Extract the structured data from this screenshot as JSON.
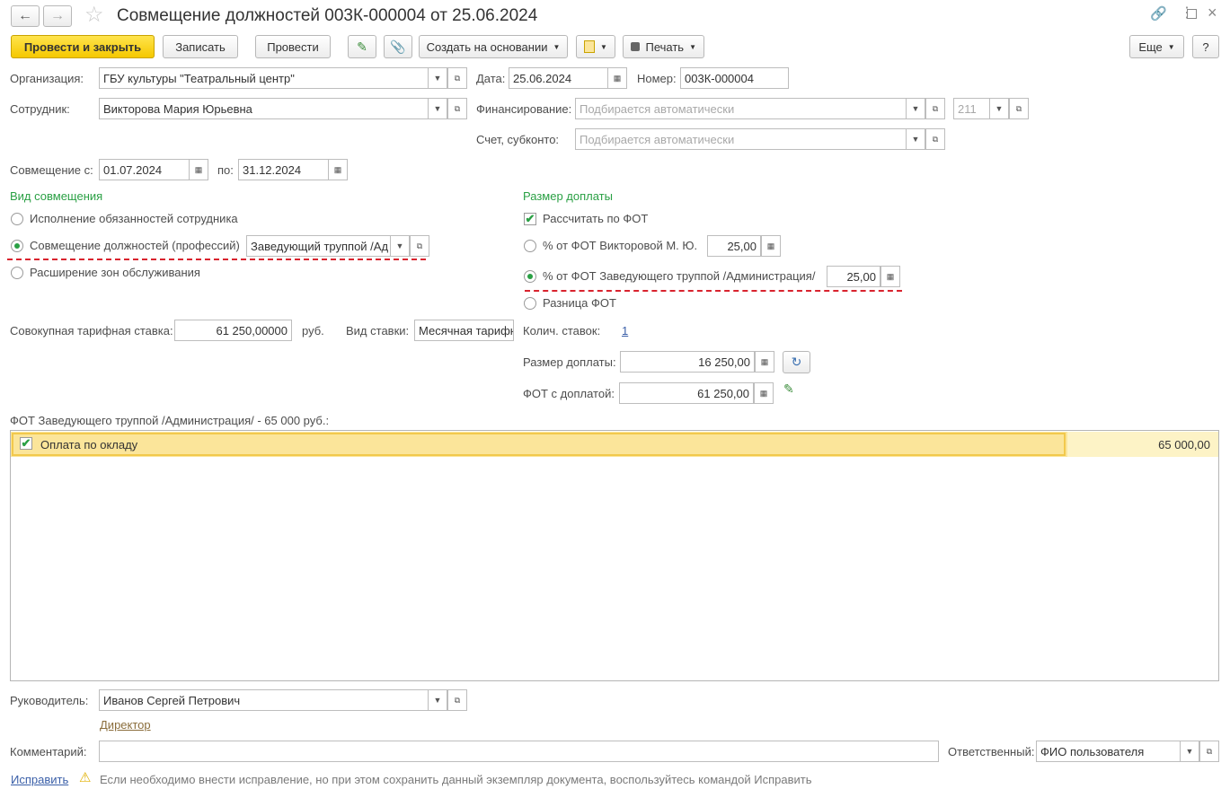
{
  "window": {
    "title": "Совмещение должностей 003К-000004 от 25.06.2024"
  },
  "toolbar": {
    "post_close": "Провести и закрыть",
    "save": "Записать",
    "post": "Провести",
    "create_based": "Создать на основании",
    "print": "Печать",
    "more": "Еще",
    "help": "?"
  },
  "form": {
    "org_label": "Организация:",
    "org_value": "ГБУ культуры \"Театральный центр\"",
    "date_label": "Дата:",
    "date_value": "25.06.2024",
    "number_label": "Номер:",
    "number_value": "003К-000004",
    "employee_label": "Сотрудник:",
    "employee_value": "Викторова Мария Юрьевна",
    "financing_label": "Финансирование:",
    "financing_placeholder": "Подбирается автоматически",
    "financing_code": "211",
    "account_label": "Счет, субконто:",
    "account_placeholder": "Подбирается автоматически",
    "combo_from_label": "Совмещение с:",
    "combo_from_value": "01.07.2024",
    "combo_to_label": "по:",
    "combo_to_value": "31.12.2024"
  },
  "kind": {
    "header": "Вид совмещения",
    "opt1": "Исполнение обязанностей сотрудника",
    "opt2": "Совмещение должностей (профессий)",
    "opt2_position": "Заведующий труппой /Ад",
    "opt3": "Расширение зон обслуживания"
  },
  "surcharge": {
    "header": "Размер доплаты",
    "calc_by_fot": "Рассчитать по ФОТ",
    "opt_pct_own": "% от ФОТ Викторовой М. Ю.",
    "opt_pct_own_value": "25,00",
    "opt_pct_other": "% от ФОТ Заведующего труппой /Администрация/",
    "opt_pct_other_value": "25,00",
    "opt_diff": "Разница ФОТ"
  },
  "rates": {
    "total_rate_label": "Совокупная тарифная ставка:",
    "total_rate_value": "61 250,00000",
    "currency": "руб.",
    "rate_kind_label": "Вид ставки:",
    "rate_kind_value": "Месячная тарифн",
    "count_label": "Колич. ставок:",
    "count_value": "1",
    "amount_label": "Размер доплаты:",
    "amount_value": "16 250,00",
    "fot_label": "ФОТ с доплатой:",
    "fot_value": "61 250,00"
  },
  "fot_table": {
    "caption": "ФОТ Заведующего труппой /Администрация/ - 65 000 руб.:",
    "rows": [
      {
        "name": "Оплата по окладу",
        "amount": "65 000,00"
      }
    ]
  },
  "footer": {
    "manager_label": "Руководитель:",
    "manager_value": "Иванов Сергей Петрович",
    "manager_position": "Директор",
    "comment_label": "Комментарий:",
    "responsible_label": "Ответственный:",
    "responsible_value": "ФИО пользователя",
    "fix_link": "Исправить",
    "fix_hint": "Если необходимо внести исправление, но при этом сохранить данный экземпляр документа, воспользуйтесь командой Исправить"
  },
  "colors": {
    "accent_green": "#2aa044",
    "primary_yellow": "#f5c800",
    "highlight_row": "#fbe59a",
    "annotation_red": "#d9232e"
  }
}
